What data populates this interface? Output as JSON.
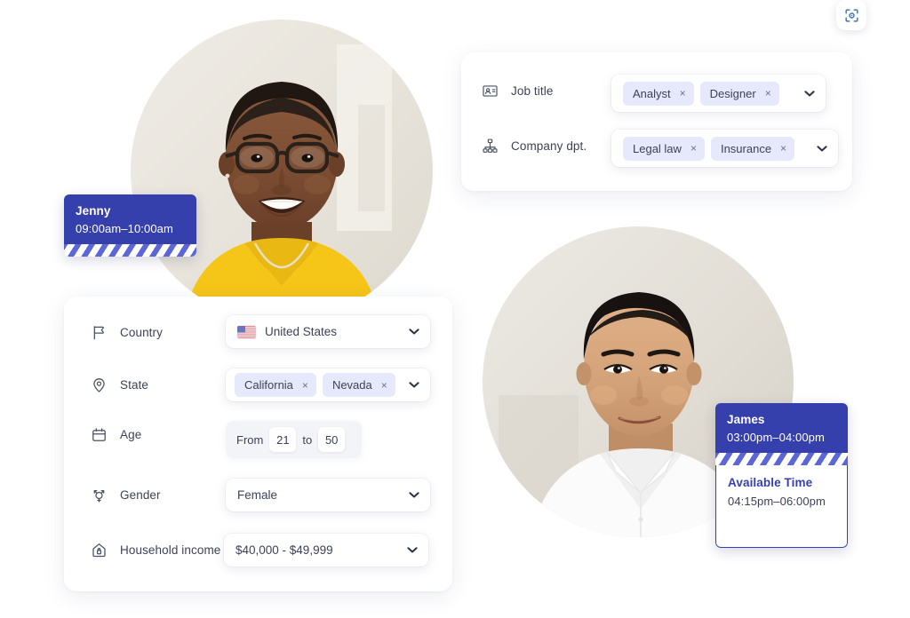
{
  "toolbar": {
    "scan_button_label": "",
    "scan_icon": "scan-focus-icon"
  },
  "job_panel": {
    "rows": [
      {
        "icon": "id-badge-icon",
        "label": "Job title",
        "tags": [
          {
            "label": "Analyst",
            "remove": "×"
          },
          {
            "label": "Designer",
            "remove": "×"
          }
        ]
      },
      {
        "icon": "org-chart-icon",
        "label": "Company dpt.",
        "tags": [
          {
            "label": "Legal law",
            "remove": "×"
          },
          {
            "label": "Insurance",
            "remove": "×"
          }
        ]
      }
    ]
  },
  "filters_panel": {
    "country": {
      "icon": "flag-icon",
      "label": "Country",
      "value": "United States",
      "flag": "us-flag-icon"
    },
    "state": {
      "icon": "map-pin-icon",
      "label": "State",
      "tags": [
        {
          "label": "California",
          "remove": "×"
        },
        {
          "label": "Nevada",
          "remove": "×"
        }
      ]
    },
    "age": {
      "icon": "calendar-icon",
      "label": "Age",
      "from_label": "From",
      "from_value": "21",
      "to_label": "to",
      "to_value": "50"
    },
    "gender": {
      "icon": "gender-icon",
      "label": "Gender",
      "value": "Female"
    },
    "income": {
      "icon": "house-lock-icon",
      "label": "Household income",
      "value": "$40,000 - $49,999"
    }
  },
  "schedule": {
    "jenny": {
      "name": "Jenny",
      "time": "09:00am–10:00am"
    },
    "james": {
      "name": "James",
      "time": "03:00pm–04:00pm",
      "available_title": "Available Time",
      "available_time": "04:15pm–06:00pm"
    }
  },
  "people": {
    "jenny_alt": "Smiling woman with glasses in yellow top",
    "james_alt": "Smiling man in white shirt"
  },
  "colors": {
    "accent": "#3640ad",
    "tag_bg": "#e6e8fb",
    "text": "#3c4257",
    "page_bg": "#ffffff"
  }
}
